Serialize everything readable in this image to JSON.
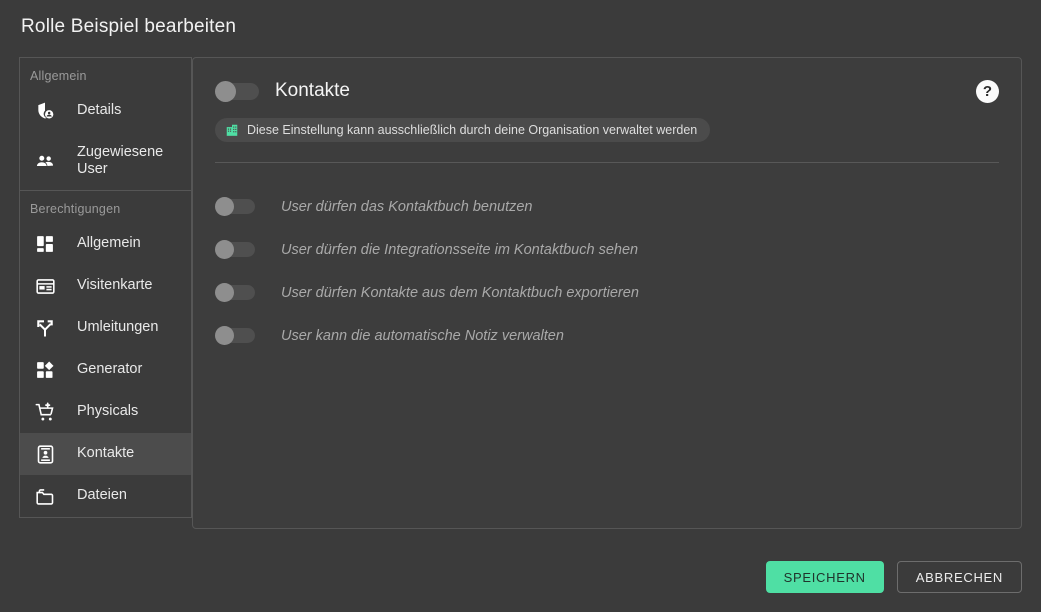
{
  "header": {
    "title": "Rolle Beispiel bearbeiten"
  },
  "sidebar": {
    "groups": [
      {
        "heading": "Allgemein",
        "items": [
          {
            "label": "Details",
            "icon": "shield-user-icon",
            "active": false
          },
          {
            "label": "Zugewiesene User",
            "icon": "people-icon",
            "active": false
          }
        ]
      },
      {
        "heading": "Berechtigungen",
        "items": [
          {
            "label": "Allgemein",
            "icon": "dashboard-grid-icon",
            "active": false
          },
          {
            "label": "Visitenkarte",
            "icon": "id-card-icon",
            "active": false
          },
          {
            "label": "Umleitungen",
            "icon": "branch-arrow-icon",
            "active": false
          },
          {
            "label": "Generator",
            "icon": "shapes-grid-icon",
            "active": false
          },
          {
            "label": "Physicals",
            "icon": "cart-plus-icon",
            "active": false
          },
          {
            "label": "Kontakte",
            "icon": "contact-card-icon",
            "active": true
          },
          {
            "label": "Dateien",
            "icon": "folder-icon",
            "active": false
          }
        ]
      }
    ]
  },
  "content": {
    "title": "Kontakte",
    "help_icon": "question-mark-icon",
    "master_toggle": {
      "name": "kontakte-master-toggle",
      "state": "off"
    },
    "org_banner": {
      "icon": "organization-building-icon",
      "text": "Diese Einstellung kann ausschließlich durch deine Organisation verwaltet werden"
    },
    "permissions": [
      {
        "label": "User dürfen das Kontaktbuch benutzen",
        "state": "off"
      },
      {
        "label": "User dürfen die Integrationsseite im Kontaktbuch sehen",
        "state": "off"
      },
      {
        "label": "User dürfen Kontakte aus dem Kontaktbuch exportieren",
        "state": "off"
      },
      {
        "label": "User kann die automatische Notiz verwalten",
        "state": "off"
      }
    ]
  },
  "footer": {
    "save_label": "SPEICHERN",
    "cancel_label": "ABBRECHEN"
  },
  "colors": {
    "page_background": "#3b3b3b",
    "panel_border": "#565656",
    "accent_green": "#4fdfa4",
    "active_item": "#4c4c4c",
    "muted_text": "#9a9a9a"
  }
}
